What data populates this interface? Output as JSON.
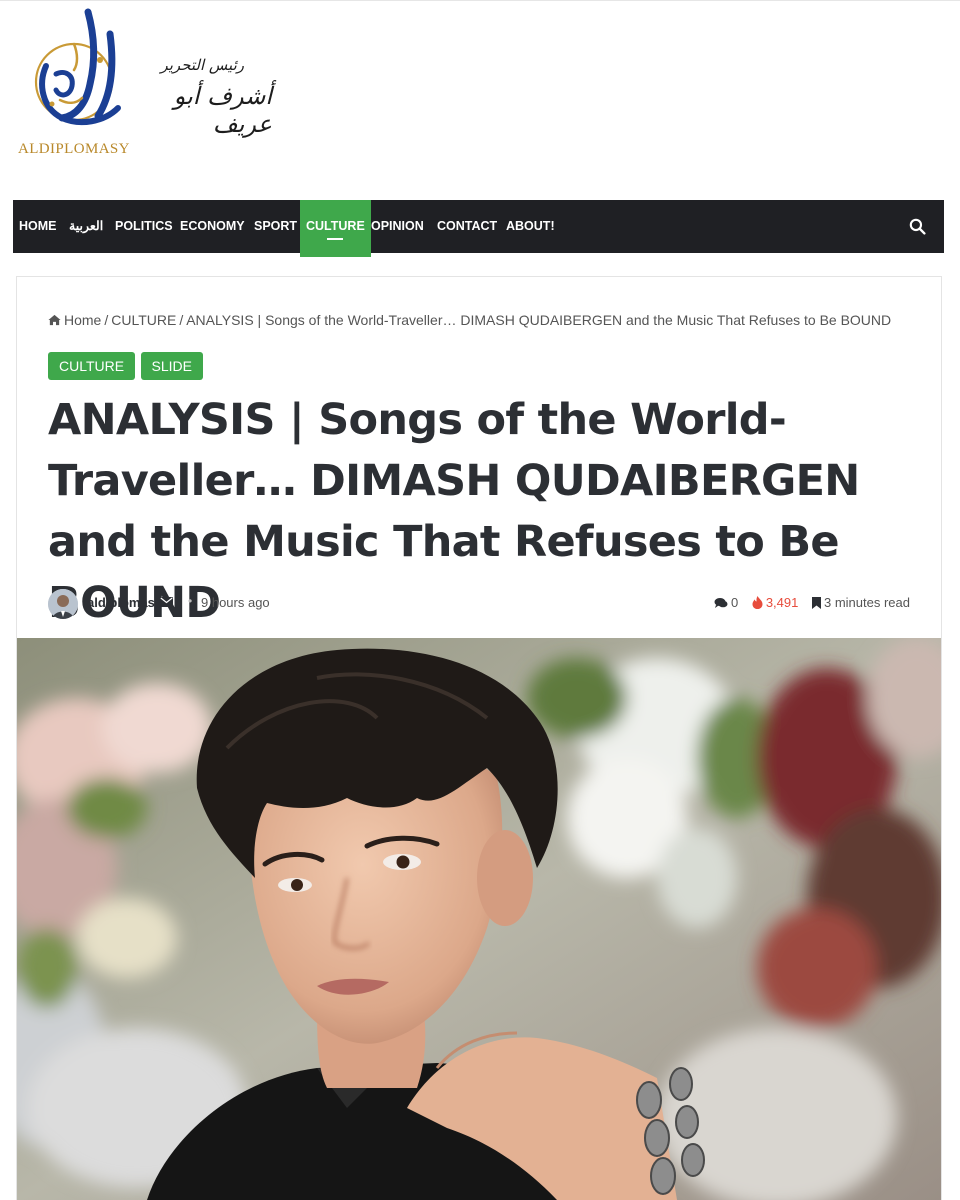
{
  "site": {
    "logo_text": "ALDIPLOMASY",
    "editor_role": "رئيس التحرير",
    "editor_name": "أشرف أبو عريف"
  },
  "nav": {
    "items": [
      {
        "label": "HOME"
      },
      {
        "label": "العربية"
      },
      {
        "label": "POLITICS"
      },
      {
        "label": "ECONOMY"
      },
      {
        "label": "SPORT"
      },
      {
        "label": "CULTURE",
        "active": true
      },
      {
        "label": "OPINION"
      },
      {
        "label": "CONTACT"
      },
      {
        "label": "ABOUT!"
      }
    ],
    "search_icon": "search-icon"
  },
  "breadcrumb": {
    "home": "Home",
    "section": "CULTURE",
    "current": "ANALYSIS | Songs of the World-Traveller… DIMASH QUDAIBERGEN and the Music That Refuses to Be BOUND",
    "separator": "/"
  },
  "tags": [
    "CULTURE",
    "SLIDE"
  ],
  "article": {
    "title": "ANALYSIS | Songs of the World-Traveller… DIMASH QUDAIBERGEN and the Music That Refuses to Be BOUND",
    "author": "aldiplomasy",
    "time": "9 hours ago",
    "comments": "0",
    "views": "3,491",
    "read_time": "3 minutes read"
  },
  "colors": {
    "accent": "#3fa84b",
    "nav_bg": "#1f2024",
    "views": "#e74c3c",
    "logo_gold": "#b9892b",
    "logo_blue": "#1b3f94"
  }
}
